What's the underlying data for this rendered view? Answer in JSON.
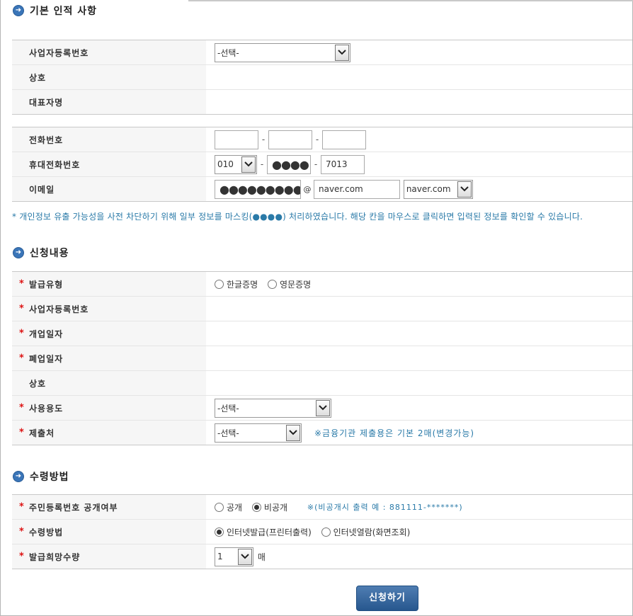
{
  "basic": {
    "title": "기본 인적 사항",
    "biz_no_label": "사업자등록번호",
    "biz_no_select": "-선택-",
    "company_label": "상호",
    "ceo_label": "대표자명",
    "phone_label": "전화번호",
    "phone": [
      "",
      "",
      ""
    ],
    "mobile_label": "휴대전화번호",
    "mobile_prefix": "010",
    "mobile_mid": "●●●●",
    "mobile_last": "7013",
    "email_label": "이메일",
    "email_id": "●●●●●●●●●",
    "email_at": "@",
    "email_domain": "naver.com",
    "email_domain_select": "naver.com",
    "dash": "-"
  },
  "notice": "* 개인정보 유출 가능성을 사전 차단하기 위해 일부 정보를 마스킹(●●●●) 처리하였습니다. 해당 칸을 마우스로 클릭하면 입력된 정보를 확인할 수 있습니다.",
  "request": {
    "title": "신청내용",
    "issue_type_label": "발급유형",
    "issue_type_options": [
      "한글증명",
      "영문증명"
    ],
    "biz_no_label": "사업자등록번호",
    "open_date_label": "개업일자",
    "close_date_label": "폐업일자",
    "company_label": "상호",
    "usage_label": "사용용도",
    "usage_select": "-선택-",
    "submit_to_label": "제출처",
    "submit_to_select": "-선택-",
    "submit_to_hint": "※금융기관 제출용은 기본 2매(변경가능)"
  },
  "receive": {
    "title": "수령방법",
    "rrn_label": "주민등록번호 공개여부",
    "rrn_options": [
      "공개",
      "비공개"
    ],
    "rrn_hint": "※(비공개시 출력 예 : 881111-*******)",
    "method_label": "수령방법",
    "method_options": [
      "인터넷발급(프린터출력)",
      "인터넷열람(화면조회)"
    ],
    "qty_label": "발급희망수량",
    "qty_value": "1",
    "qty_unit": "매"
  },
  "submit_label": "신청하기"
}
